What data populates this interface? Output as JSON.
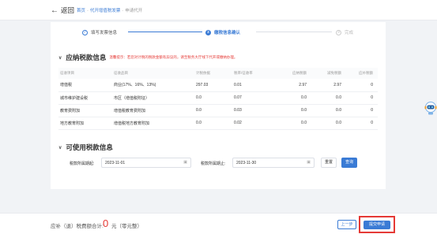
{
  "header": {
    "back_label": "返回",
    "breadcrumb": [
      "首页",
      "代开增值税发票",
      "申请代开"
    ]
  },
  "steps": [
    {
      "index": "✓",
      "label": "填写发票信息"
    },
    {
      "index": "2",
      "label": "缴税信息确认"
    },
    {
      "index": "3",
      "label": "完成"
    }
  ],
  "section1": {
    "title": "应纳税款信息",
    "warning": "温馨提示：若您对计税的税款金额有异议的，请至税务大厅线下代开或缴纳办理。"
  },
  "table": {
    "columns": [
      "征收项目",
      "征收品目",
      "计税依据",
      "税率/征收率",
      "应纳税额",
      "减免税额",
      "应补税额"
    ],
    "rows": [
      [
        "增值税",
        "商业(17%、16%、13%)",
        "297.03",
        "0.01",
        "2.97",
        "2.97",
        "0"
      ],
      [
        "城市维护建设税",
        "市区（增值税附征）",
        "0.0",
        "0.07",
        "0.0",
        "0.0",
        "0"
      ],
      [
        "教育费附加",
        "增值税教育费附加",
        "0.0",
        "0.03",
        "0.0",
        "0.0",
        "0"
      ],
      [
        "地方教育附加",
        "增值税地方教育附加",
        "0.0",
        "0.02",
        "0.0",
        "0.0",
        "0"
      ]
    ]
  },
  "section2": {
    "title": "可使用税款信息"
  },
  "filter": {
    "start_label": "税款所属期起:",
    "start_value": "2023-11-01",
    "end_label": "税款所属期止:",
    "end_value": "2023-11-30",
    "reset_label": "重置",
    "query_label": "查询"
  },
  "footer": {
    "total_label": "应补（退）税费额合计:",
    "total_value": "0",
    "total_unit": "元（零元整）",
    "prev_label": "上一步",
    "submit_label": "提交申请"
  },
  "colors": {
    "accent": "#3a7bd5",
    "warning": "#e53935"
  }
}
